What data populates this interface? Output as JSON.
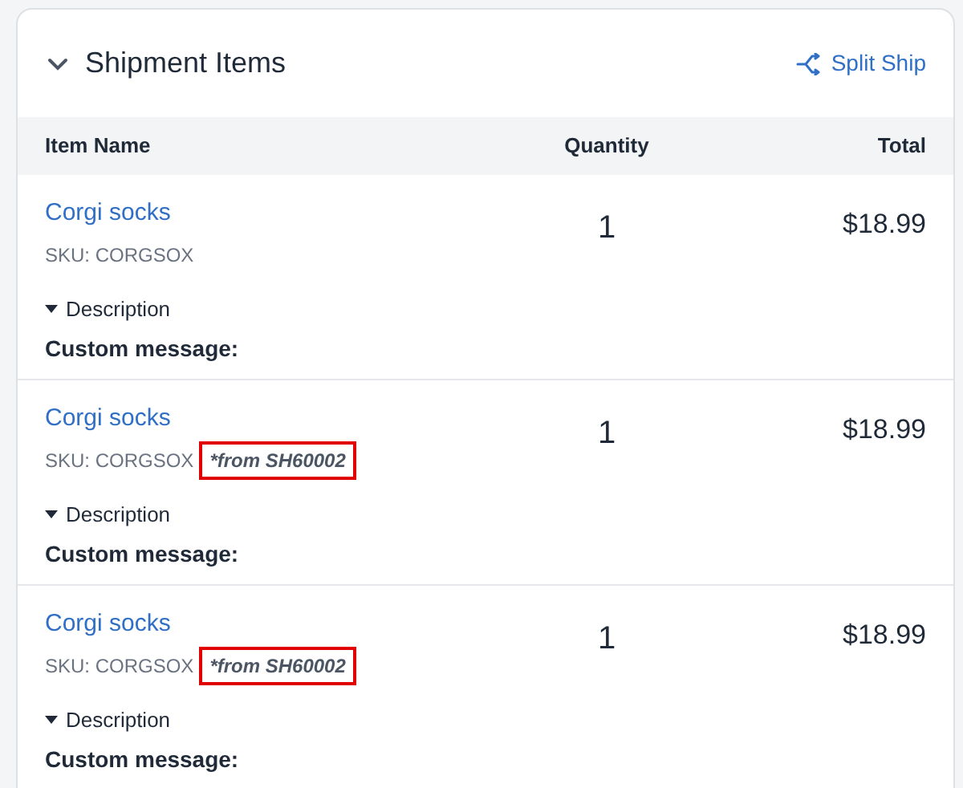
{
  "section": {
    "title": "Shipment Items",
    "expanded": true,
    "action": "Split Ship"
  },
  "table": {
    "columns": [
      "Item Name",
      "Quantity",
      "Total"
    ],
    "rows": [
      {
        "name": "Corgi socks",
        "sku": "SKU: CORGSOX",
        "quantity": "1",
        "total": "$18.99",
        "description": "Description",
        "custom_message": "Custom message:"
      },
      {
        "name": "Corgi socks",
        "sku": "SKU: CORGSOX",
        "origin": "*from SH60002",
        "highlighted": true,
        "quantity": "1",
        "total": "$18.99",
        "description": "Description",
        "custom_message": "Custom message:"
      },
      {
        "name": "Corgi socks",
        "sku": "SKU: CORGSOX",
        "origin": "*from SH60002",
        "highlighted": true,
        "quantity": "1",
        "total": "$18.99",
        "description": "Description",
        "custom_message": "Custom message:"
      }
    ]
  }
}
